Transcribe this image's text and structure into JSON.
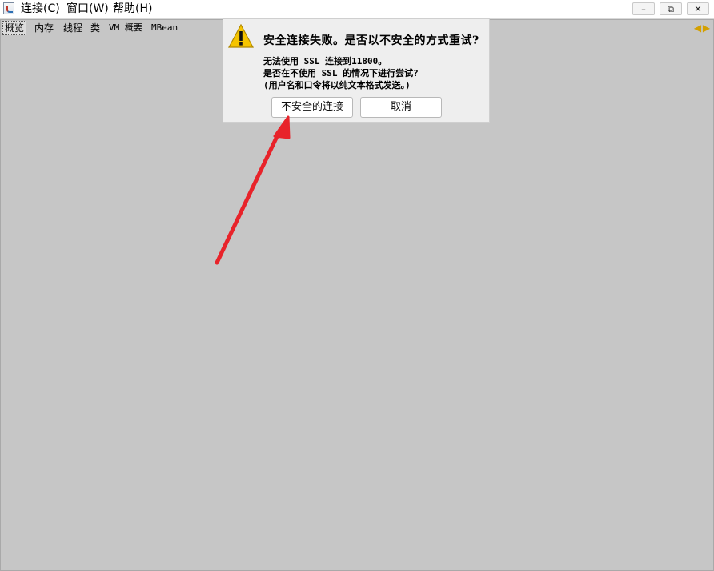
{
  "menubar": {
    "items": [
      {
        "label": "连接(C)"
      },
      {
        "label": "窗口(W)"
      },
      {
        "label": "帮助(H)"
      }
    ]
  },
  "window_controls": {
    "minimize": "–",
    "restore": "⧉",
    "close": "✕"
  },
  "tabs": [
    {
      "label": "概览"
    },
    {
      "label": "内存"
    },
    {
      "label": "线程"
    },
    {
      "label": "类"
    },
    {
      "label": "VM 概要"
    },
    {
      "label": "MBean"
    }
  ],
  "dialog": {
    "title": "安全连接失败。是否以不安全的方式重试?",
    "lines": [
      "无法使用 SSL 连接到11800。",
      "是否在不使用 SSL 的情况下进行尝试?",
      "(用户名和口令将以纯文本格式发送。)"
    ],
    "insecure_button": "不安全的连接",
    "cancel_button": "取消"
  },
  "colors": {
    "arrow": "#e8232a",
    "warning": "#f5c400"
  }
}
